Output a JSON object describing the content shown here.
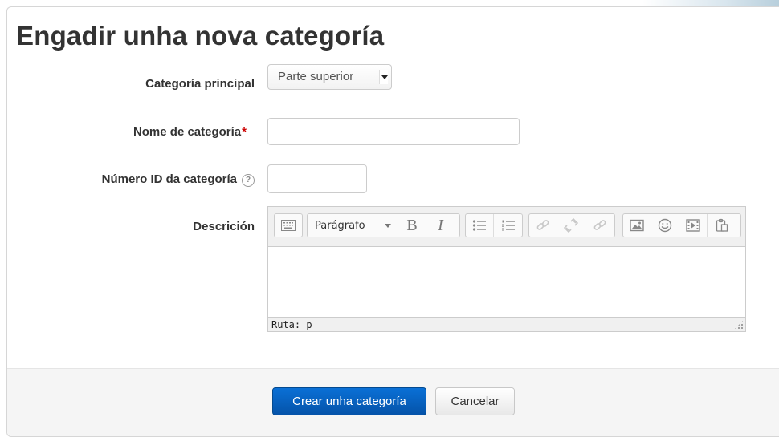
{
  "page": {
    "title": "Engadir unha nova categoría"
  },
  "form": {
    "parent": {
      "label": "Categoría principal",
      "value": "Parte superior"
    },
    "name": {
      "label": "Nome de categoría",
      "required_mark": "*",
      "value": ""
    },
    "idnumber": {
      "label": "Número ID da categoría",
      "value": ""
    },
    "description": {
      "label": "Descrición"
    }
  },
  "editor": {
    "format_value": "Parágrafo",
    "path_label": "Ruta: p",
    "toolbar_icons": [
      "toolbar-toggle-icon",
      "bold-icon",
      "italic-icon",
      "unordered-list-icon",
      "ordered-list-icon",
      "link-icon",
      "unlink-icon",
      "anchor-icon",
      "image-icon",
      "emoticon-icon",
      "media-icon",
      "paste-icon"
    ]
  },
  "actions": {
    "submit": "Crear unha categoría",
    "cancel": "Cancelar"
  },
  "colors": {
    "primary": "#0553a9",
    "required": "#cc0000"
  }
}
